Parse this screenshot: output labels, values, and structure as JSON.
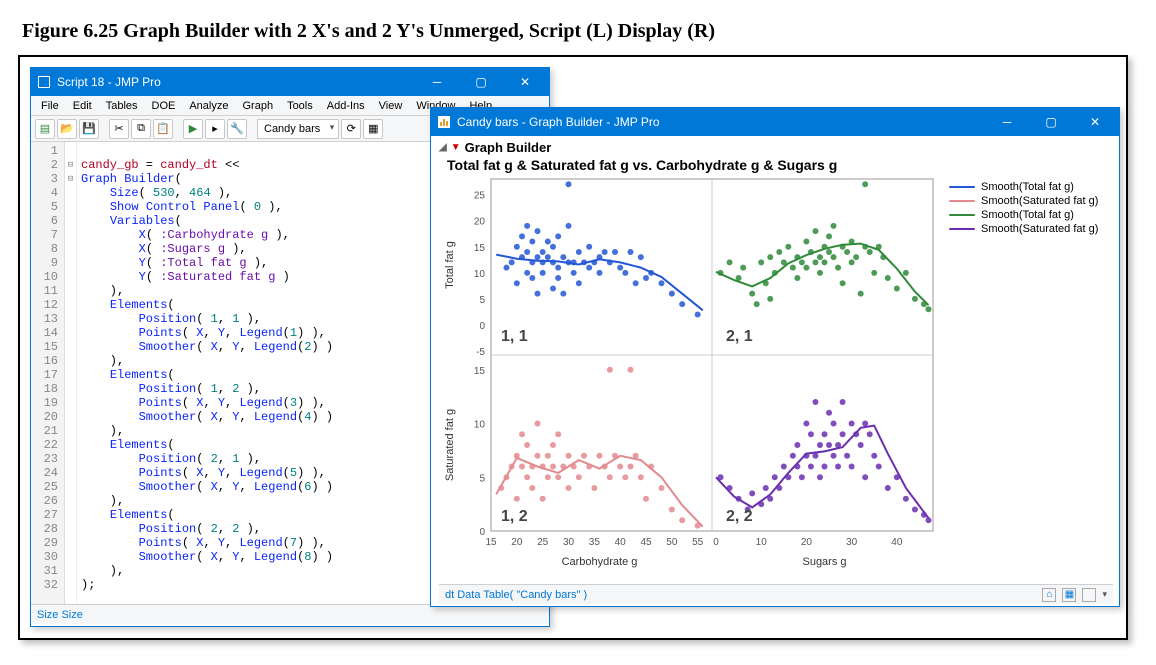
{
  "figure_caption": "Figure 6.25  Graph Builder with 2 X's and 2 Y's Unmerged, Script (L) Display (R)",
  "script_window": {
    "title": "Script 18 - JMP Pro",
    "menu": [
      "File",
      "Edit",
      "Tables",
      "DOE",
      "Analyze",
      "Graph",
      "Tools",
      "Add-Ins",
      "View",
      "Window",
      "Help"
    ],
    "toolbar_dropdown": "Candy bars",
    "status": "Size Size"
  },
  "code": {
    "raw": "\ncandy_gb = candy_dt <<\nGraph Builder(\n    Size( 530, 464 ),\n    Show Control Panel( 0 ),\n    Variables(\n        X( :Carbohydrate g ),\n        X( :Sugars g ),\n        Y( :Total fat g ),\n        Y( :Saturated fat g )\n    ),\n    Elements(\n        Position( 1, 1 ),\n        Points( X, Y, Legend(1) ),\n        Smoother( X, Y, Legend(2) )\n    ),\n    Elements(\n        Position( 1, 2 ),\n        Points( X, Y, Legend(3) ),\n        Smoother( X, Y, Legend(4) )\n    ),\n    Elements(\n        Position( 2, 1 ),\n        Points( X, Y, Legend(5) ),\n        Smoother( X, Y, Legend(6) )\n    ),\n    Elements(\n        Position( 2, 2 ),\n        Points( X, Y, Legend(7) ),\n        Smoother( X, Y, Legend(8) )\n    ),\n);",
    "line_count": 32
  },
  "graph_window": {
    "title": "Candy bars - Graph Builder - JMP Pro",
    "header": "Graph Builder",
    "chart_title": "Total fat g & Saturated fat g vs. Carbohydrate g & Sugars g",
    "status": "dt Data Table( \"Candy bars\" )"
  },
  "legend": [
    {
      "label": "Smooth(Total fat g)",
      "color": "#2457d6"
    },
    {
      "label": "Smooth(Saturated fat g)",
      "color": "#e38a8f"
    },
    {
      "label": "Smooth(Total fat g)",
      "color": "#2f8a3a"
    },
    {
      "label": "Smooth(Saturated fat g)",
      "color": "#6a2fb0"
    }
  ],
  "chart_data": [
    {
      "type": "scatter",
      "panel": "1, 1",
      "xlabel": "Carbohydrate g",
      "ylabel": "Total fat g",
      "xlim": [
        15,
        57
      ],
      "ylim": [
        -5,
        28
      ],
      "yticks": [
        -5,
        0,
        5,
        10,
        15,
        20,
        25
      ],
      "color": "#2457d6",
      "points": [
        [
          18,
          11
        ],
        [
          19,
          12
        ],
        [
          20,
          15
        ],
        [
          20,
          8
        ],
        [
          21,
          13
        ],
        [
          21,
          17
        ],
        [
          22,
          14
        ],
        [
          22,
          10
        ],
        [
          22,
          19
        ],
        [
          23,
          12
        ],
        [
          23,
          16
        ],
        [
          23,
          9
        ],
        [
          24,
          13
        ],
        [
          24,
          6
        ],
        [
          24,
          18
        ],
        [
          25,
          12
        ],
        [
          25,
          14
        ],
        [
          25,
          10
        ],
        [
          26,
          13
        ],
        [
          26,
          16
        ],
        [
          27,
          7
        ],
        [
          27,
          12
        ],
        [
          27,
          15
        ],
        [
          28,
          11
        ],
        [
          28,
          9
        ],
        [
          28,
          17
        ],
        [
          29,
          13
        ],
        [
          29,
          6
        ],
        [
          30,
          12
        ],
        [
          30,
          27
        ],
        [
          30,
          19
        ],
        [
          31,
          12
        ],
        [
          31,
          10
        ],
        [
          32,
          14
        ],
        [
          32,
          8
        ],
        [
          33,
          12
        ],
        [
          34,
          11
        ],
        [
          34,
          15
        ],
        [
          35,
          12
        ],
        [
          36,
          10
        ],
        [
          36,
          13
        ],
        [
          37,
          14
        ],
        [
          38,
          12
        ],
        [
          39,
          14
        ],
        [
          40,
          11
        ],
        [
          41,
          10
        ],
        [
          42,
          14
        ],
        [
          43,
          8
        ],
        [
          44,
          13
        ],
        [
          45,
          9
        ],
        [
          46,
          10
        ],
        [
          48,
          8
        ],
        [
          50,
          6
        ],
        [
          52,
          4
        ],
        [
          55,
          2
        ]
      ],
      "smooth": [
        [
          16,
          13.5
        ],
        [
          20,
          12.7
        ],
        [
          24,
          12.3
        ],
        [
          28,
          12.2
        ],
        [
          32,
          11.6
        ],
        [
          36,
          12.6
        ],
        [
          40,
          12.0
        ],
        [
          44,
          11.0
        ],
        [
          48,
          9.2
        ],
        [
          52,
          6.0
        ],
        [
          56,
          2.8
        ]
      ]
    },
    {
      "type": "scatter",
      "panel": "2, 1",
      "xlabel": "Sugars g",
      "ylabel": "Total fat g",
      "xlim": [
        0,
        48
      ],
      "ylim": [
        -5,
        28
      ],
      "color": "#2f8a3a",
      "points": [
        [
          1,
          10
        ],
        [
          3,
          12
        ],
        [
          5,
          9
        ],
        [
          6,
          11
        ],
        [
          8,
          6
        ],
        [
          9,
          4
        ],
        [
          10,
          12
        ],
        [
          11,
          8
        ],
        [
          12,
          13
        ],
        [
          12,
          5
        ],
        [
          13,
          10
        ],
        [
          14,
          14
        ],
        [
          15,
          12
        ],
        [
          16,
          15
        ],
        [
          17,
          11
        ],
        [
          18,
          13
        ],
        [
          18,
          9
        ],
        [
          19,
          12
        ],
        [
          20,
          16
        ],
        [
          20,
          11
        ],
        [
          21,
          14
        ],
        [
          22,
          12
        ],
        [
          22,
          18
        ],
        [
          23,
          13
        ],
        [
          23,
          10
        ],
        [
          24,
          15
        ],
        [
          24,
          12
        ],
        [
          25,
          14
        ],
        [
          25,
          17
        ],
        [
          26,
          13
        ],
        [
          26,
          19
        ],
        [
          27,
          11
        ],
        [
          28,
          15
        ],
        [
          28,
          8
        ],
        [
          29,
          14
        ],
        [
          30,
          16
        ],
        [
          30,
          12
        ],
        [
          31,
          13
        ],
        [
          32,
          6
        ],
        [
          33,
          15
        ],
        [
          33,
          27
        ],
        [
          34,
          14
        ],
        [
          35,
          10
        ],
        [
          36,
          15
        ],
        [
          37,
          13
        ],
        [
          38,
          9
        ],
        [
          40,
          7
        ],
        [
          42,
          10
        ],
        [
          44,
          5
        ],
        [
          46,
          4
        ],
        [
          47,
          3
        ]
      ],
      "smooth": [
        [
          0,
          10.2
        ],
        [
          4,
          8.6
        ],
        [
          8,
          7.4
        ],
        [
          12,
          9.0
        ],
        [
          16,
          11.8
        ],
        [
          20,
          13.4
        ],
        [
          24,
          14.6
        ],
        [
          28,
          15.4
        ],
        [
          32,
          15.6
        ],
        [
          36,
          14.4
        ],
        [
          40,
          10.8
        ],
        [
          44,
          6.4
        ],
        [
          47,
          3.8
        ]
      ]
    },
    {
      "type": "scatter",
      "panel": "1, 2",
      "xlabel": "Carbohydrate g",
      "ylabel": "Saturated fat g",
      "xlim": [
        15,
        57
      ],
      "ylim": [
        0,
        16
      ],
      "yticks": [
        0,
        5,
        10,
        15
      ],
      "color": "#e38a8f",
      "points": [
        [
          17,
          4
        ],
        [
          18,
          5
        ],
        [
          19,
          6
        ],
        [
          20,
          7
        ],
        [
          20,
          3
        ],
        [
          21,
          6
        ],
        [
          21,
          9
        ],
        [
          22,
          5
        ],
        [
          22,
          8
        ],
        [
          23,
          6
        ],
        [
          23,
          4
        ],
        [
          24,
          7
        ],
        [
          24,
          10
        ],
        [
          25,
          6
        ],
        [
          25,
          3
        ],
        [
          26,
          7
        ],
        [
          26,
          5
        ],
        [
          27,
          6
        ],
        [
          27,
          8
        ],
        [
          28,
          5
        ],
        [
          28,
          9
        ],
        [
          29,
          6
        ],
        [
          30,
          7
        ],
        [
          30,
          4
        ],
        [
          31,
          6
        ],
        [
          32,
          5
        ],
        [
          33,
          7
        ],
        [
          34,
          6
        ],
        [
          35,
          4
        ],
        [
          36,
          7
        ],
        [
          37,
          6
        ],
        [
          38,
          15
        ],
        [
          38,
          5
        ],
        [
          39,
          7
        ],
        [
          40,
          6
        ],
        [
          41,
          5
        ],
        [
          42,
          15
        ],
        [
          42,
          6
        ],
        [
          43,
          7
        ],
        [
          44,
          5
        ],
        [
          45,
          3
        ],
        [
          46,
          6
        ],
        [
          48,
          4
        ],
        [
          50,
          2
        ],
        [
          52,
          1
        ],
        [
          55,
          0.5
        ]
      ],
      "smooth": [
        [
          16,
          3.4
        ],
        [
          20,
          6.8
        ],
        [
          24,
          6.0
        ],
        [
          28,
          5.4
        ],
        [
          32,
          6.6
        ],
        [
          36,
          5.8
        ],
        [
          40,
          7.0
        ],
        [
          44,
          6.6
        ],
        [
          48,
          5.0
        ],
        [
          52,
          2.4
        ],
        [
          56,
          0.4
        ]
      ]
    },
    {
      "type": "scatter",
      "panel": "2, 2",
      "xlabel": "Sugars g",
      "ylabel": "Saturated fat g",
      "xlim": [
        0,
        48
      ],
      "ylim": [
        0,
        16
      ],
      "color": "#6a2fb0",
      "points": [
        [
          1,
          5
        ],
        [
          3,
          4
        ],
        [
          5,
          3
        ],
        [
          7,
          2
        ],
        [
          8,
          3.5
        ],
        [
          10,
          2.5
        ],
        [
          11,
          4
        ],
        [
          12,
          3
        ],
        [
          13,
          5
        ],
        [
          14,
          4
        ],
        [
          15,
          6
        ],
        [
          16,
          5
        ],
        [
          17,
          7
        ],
        [
          18,
          6
        ],
        [
          18,
          8
        ],
        [
          19,
          5
        ],
        [
          20,
          7
        ],
        [
          20,
          10
        ],
        [
          21,
          6
        ],
        [
          21,
          9
        ],
        [
          22,
          7
        ],
        [
          22,
          12
        ],
        [
          23,
          8
        ],
        [
          23,
          5
        ],
        [
          24,
          9
        ],
        [
          24,
          6
        ],
        [
          25,
          8
        ],
        [
          25,
          11
        ],
        [
          26,
          7
        ],
        [
          26,
          10
        ],
        [
          27,
          8
        ],
        [
          27,
          6
        ],
        [
          28,
          9
        ],
        [
          28,
          12
        ],
        [
          29,
          7
        ],
        [
          30,
          10
        ],
        [
          30,
          6
        ],
        [
          31,
          9
        ],
        [
          32,
          8
        ],
        [
          33,
          10
        ],
        [
          33,
          5
        ],
        [
          34,
          9
        ],
        [
          35,
          7
        ],
        [
          36,
          6
        ],
        [
          38,
          4
        ],
        [
          40,
          5
        ],
        [
          42,
          3
        ],
        [
          44,
          2
        ],
        [
          46,
          1.5
        ],
        [
          47,
          1
        ]
      ],
      "smooth": [
        [
          0,
          5.0
        ],
        [
          4,
          3.2
        ],
        [
          8,
          2.2
        ],
        [
          12,
          3.4
        ],
        [
          16,
          5.4
        ],
        [
          20,
          7.2
        ],
        [
          24,
          7.4
        ],
        [
          28,
          7.8
        ],
        [
          32,
          9.6
        ],
        [
          35,
          9.8
        ],
        [
          38,
          7.2
        ],
        [
          42,
          4.0
        ],
        [
          47,
          1.2
        ]
      ]
    }
  ],
  "shared_axes": {
    "x1_ticks": [
      15,
      20,
      25,
      30,
      35,
      40,
      45,
      50,
      55
    ],
    "x2_ticks": [
      0,
      10,
      20,
      30,
      40
    ],
    "x1_label": "Carbohydrate g",
    "x2_label": "Sugars g"
  }
}
